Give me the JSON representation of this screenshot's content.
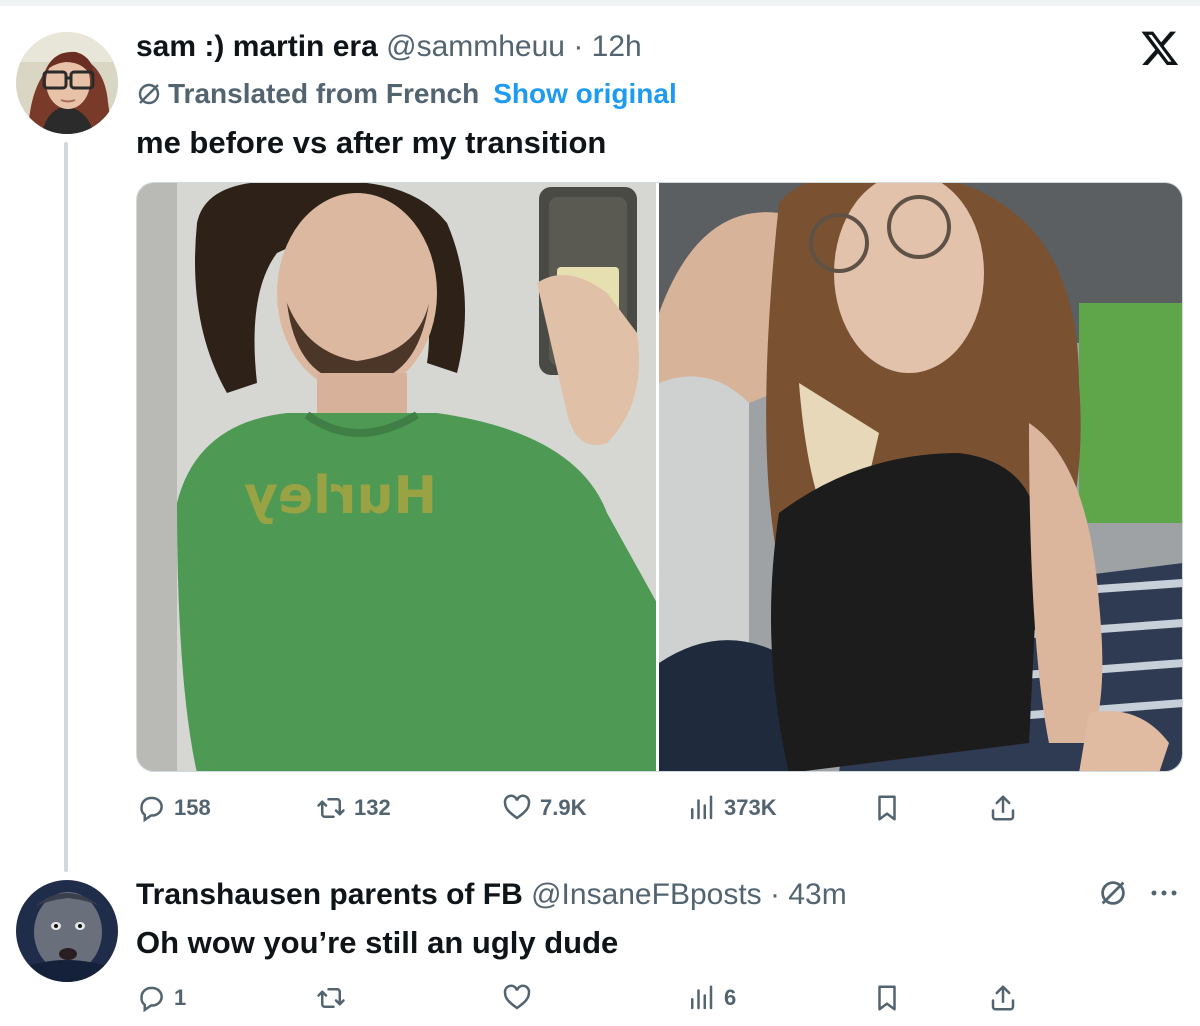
{
  "tweet": {
    "author_name": "sam :) martin era",
    "handle": "@sammheuu",
    "dot": "·",
    "time": "12h",
    "translated_label": "Translated from French",
    "show_original_label": "Show original",
    "text": "me before vs after my transition",
    "photo_left_shirt_text": "Hurley",
    "stats": {
      "replies": "158",
      "reposts": "132",
      "likes": "7.9K",
      "views": "373K"
    },
    "icons": [
      "reply-icon",
      "repost-icon",
      "like-icon",
      "views-icon",
      "bookmark-icon",
      "share-icon",
      "x-logo-icon",
      "translate-icon"
    ]
  },
  "reply": {
    "author_name": "Transhausen parents of FB",
    "handle": "@InsaneFBposts",
    "dot": "·",
    "time": "43m",
    "text": "Oh wow you’re still an ugly dude",
    "stats": {
      "replies": "1",
      "reposts": "",
      "likes": "",
      "views": "6"
    },
    "icons": [
      "reply-icon",
      "repost-icon",
      "like-icon",
      "views-icon",
      "bookmark-icon",
      "share-icon",
      "translate-icon",
      "more-icon"
    ]
  },
  "colors": {
    "text_primary": "#0f1419",
    "text_secondary": "#536471",
    "link": "#1d9bf0",
    "thread_line": "#cfd9de"
  }
}
